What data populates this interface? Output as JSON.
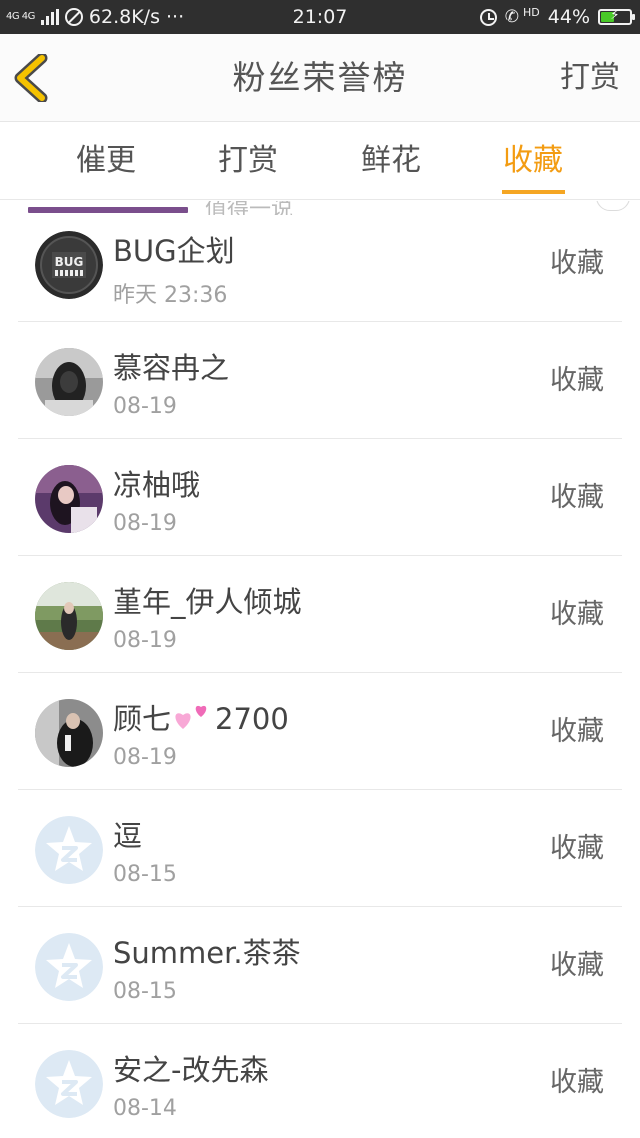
{
  "status_bar": {
    "network": "4G 4G",
    "speed": "62.8K/s",
    "more": "···",
    "time": "21:07",
    "hd": "HD",
    "battery_percent": "44%",
    "battery_level": 0.44
  },
  "header": {
    "title": "粉丝荣誉榜",
    "action_label": "打赏"
  },
  "tabs": [
    {
      "label": "催更",
      "active": false
    },
    {
      "label": "打赏",
      "active": false
    },
    {
      "label": "鲜花",
      "active": false
    },
    {
      "label": "收藏",
      "active": true
    }
  ],
  "partial_item": {
    "text": "值得一说"
  },
  "list": [
    {
      "name": "BUG企划",
      "date": "昨天 23:36",
      "action": "收藏",
      "avatar": "bug-logo-avatar"
    },
    {
      "name": "慕容冉之",
      "date": "08-19",
      "action": "收藏",
      "avatar": "photo-avatar"
    },
    {
      "name": "凉柚哦",
      "date": "08-19",
      "action": "收藏",
      "avatar": "photo-avatar"
    },
    {
      "name": "堇年_伊人倾城",
      "date": "08-19",
      "action": "收藏",
      "avatar": "photo-avatar"
    },
    {
      "name": "顾七",
      "name_suffix": "2700",
      "date": "08-19",
      "action": "收藏",
      "avatar": "photo-avatar"
    },
    {
      "name": "逗",
      "date": "08-15",
      "action": "收藏",
      "avatar": "default-qzone-avatar"
    },
    {
      "name": "Summer.茶茶",
      "date": "08-15",
      "action": "收藏",
      "avatar": "default-qzone-avatar"
    },
    {
      "name": "安之-改先森",
      "date": "08-14",
      "action": "收藏",
      "avatar": "default-qzone-avatar"
    }
  ],
  "colors": {
    "accent": "#f39c12",
    "back_icon": "#f5c200",
    "status_bar_bg": "#2f2f2f",
    "battery": "#49c928",
    "default_avatar": "#dde9f4"
  }
}
